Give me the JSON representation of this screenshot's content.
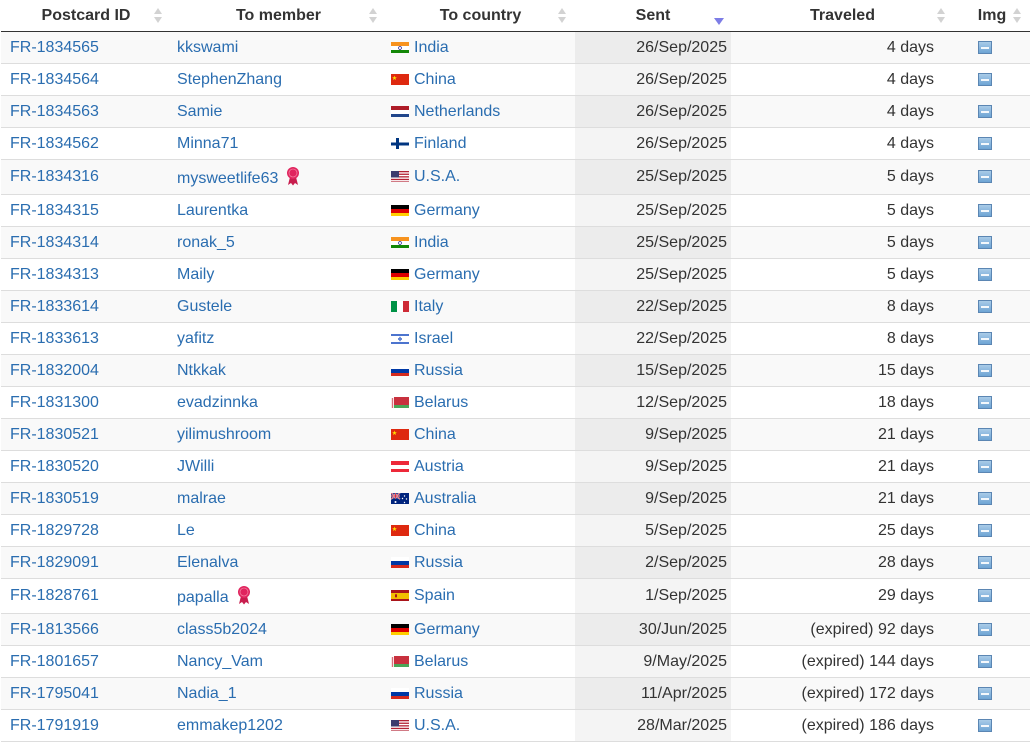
{
  "columns": [
    {
      "key": "id",
      "label": "Postcard ID",
      "sort": "none"
    },
    {
      "key": "member",
      "label": "To member",
      "sort": "none"
    },
    {
      "key": "country",
      "label": "To country",
      "sort": "none"
    },
    {
      "key": "sent",
      "label": "Sent",
      "sort": "desc"
    },
    {
      "key": "traveled",
      "label": "Traveled",
      "sort": "none"
    },
    {
      "key": "img",
      "label": "Img",
      "sort": "none"
    }
  ],
  "rows": [
    {
      "id": "FR-1834565",
      "member": "kkswami",
      "country": "India",
      "flag": "in",
      "sent": "26/Sep/2025",
      "traveled": "4 days",
      "ribbon": false
    },
    {
      "id": "FR-1834564",
      "member": "StephenZhang",
      "country": "China",
      "flag": "cn",
      "sent": "26/Sep/2025",
      "traveled": "4 days",
      "ribbon": false
    },
    {
      "id": "FR-1834563",
      "member": "Samie",
      "country": "Netherlands",
      "flag": "nl",
      "sent": "26/Sep/2025",
      "traveled": "4 days",
      "ribbon": false
    },
    {
      "id": "FR-1834562",
      "member": "Minna71",
      "country": "Finland",
      "flag": "fi",
      "sent": "26/Sep/2025",
      "traveled": "4 days",
      "ribbon": false
    },
    {
      "id": "FR-1834316",
      "member": "mysweetlife63",
      "country": "U.S.A.",
      "flag": "us",
      "sent": "25/Sep/2025",
      "traveled": "5 days",
      "ribbon": true
    },
    {
      "id": "FR-1834315",
      "member": "Laurentka",
      "country": "Germany",
      "flag": "de",
      "sent": "25/Sep/2025",
      "traveled": "5 days",
      "ribbon": false
    },
    {
      "id": "FR-1834314",
      "member": "ronak_5",
      "country": "India",
      "flag": "in",
      "sent": "25/Sep/2025",
      "traveled": "5 days",
      "ribbon": false
    },
    {
      "id": "FR-1834313",
      "member": "Maily",
      "country": "Germany",
      "flag": "de",
      "sent": "25/Sep/2025",
      "traveled": "5 days",
      "ribbon": false
    },
    {
      "id": "FR-1833614",
      "member": "Gustele",
      "country": "Italy",
      "flag": "it",
      "sent": "22/Sep/2025",
      "traveled": "8 days",
      "ribbon": false
    },
    {
      "id": "FR-1833613",
      "member": "yafitz",
      "country": "Israel",
      "flag": "il",
      "sent": "22/Sep/2025",
      "traveled": "8 days",
      "ribbon": false
    },
    {
      "id": "FR-1832004",
      "member": "Ntkkak",
      "country": "Russia",
      "flag": "ru",
      "sent": "15/Sep/2025",
      "traveled": "15 days",
      "ribbon": false
    },
    {
      "id": "FR-1831300",
      "member": "evadzinnka",
      "country": "Belarus",
      "flag": "by",
      "sent": "12/Sep/2025",
      "traveled": "18 days",
      "ribbon": false
    },
    {
      "id": "FR-1830521",
      "member": "yilimushroom",
      "country": "China",
      "flag": "cn",
      "sent": "9/Sep/2025",
      "traveled": "21 days",
      "ribbon": false
    },
    {
      "id": "FR-1830520",
      "member": "JWilli",
      "country": "Austria",
      "flag": "at",
      "sent": "9/Sep/2025",
      "traveled": "21 days",
      "ribbon": false
    },
    {
      "id": "FR-1830519",
      "member": "malrae",
      "country": "Australia",
      "flag": "au",
      "sent": "9/Sep/2025",
      "traveled": "21 days",
      "ribbon": false
    },
    {
      "id": "FR-1829728",
      "member": "Le",
      "country": "China",
      "flag": "cn",
      "sent": "5/Sep/2025",
      "traveled": "25 days",
      "ribbon": false
    },
    {
      "id": "FR-1829091",
      "member": "Elenalva",
      "country": "Russia",
      "flag": "ru",
      "sent": "2/Sep/2025",
      "traveled": "28 days",
      "ribbon": false
    },
    {
      "id": "FR-1828761",
      "member": "papalla",
      "country": "Spain",
      "flag": "es",
      "sent": "1/Sep/2025",
      "traveled": "29 days",
      "ribbon": true
    },
    {
      "id": "FR-1813566",
      "member": "class5b2024",
      "country": "Germany",
      "flag": "de",
      "sent": "30/Jun/2025",
      "traveled": "(expired) 92 days",
      "ribbon": false
    },
    {
      "id": "FR-1801657",
      "member": "Nancy_Vam",
      "country": "Belarus",
      "flag": "by",
      "sent": "9/May/2025",
      "traveled": "(expired) 144 days",
      "ribbon": false
    },
    {
      "id": "FR-1795041",
      "member": "Nadia_1",
      "country": "Russia",
      "flag": "ru",
      "sent": "11/Apr/2025",
      "traveled": "(expired) 172 days",
      "ribbon": false
    },
    {
      "id": "FR-1791919",
      "member": "emmakep1202",
      "country": "U.S.A.",
      "flag": "us",
      "sent": "28/Mar/2025",
      "traveled": "(expired) 186 days",
      "ribbon": false
    }
  ],
  "icons": {
    "image": "image-icon",
    "ribbon": "award-ribbon-icon",
    "sort": "sort-arrows-icon"
  },
  "colors": {
    "link": "#2a6db0",
    "ribbon": "#e0245e",
    "sort_active": "#7d7de6"
  }
}
